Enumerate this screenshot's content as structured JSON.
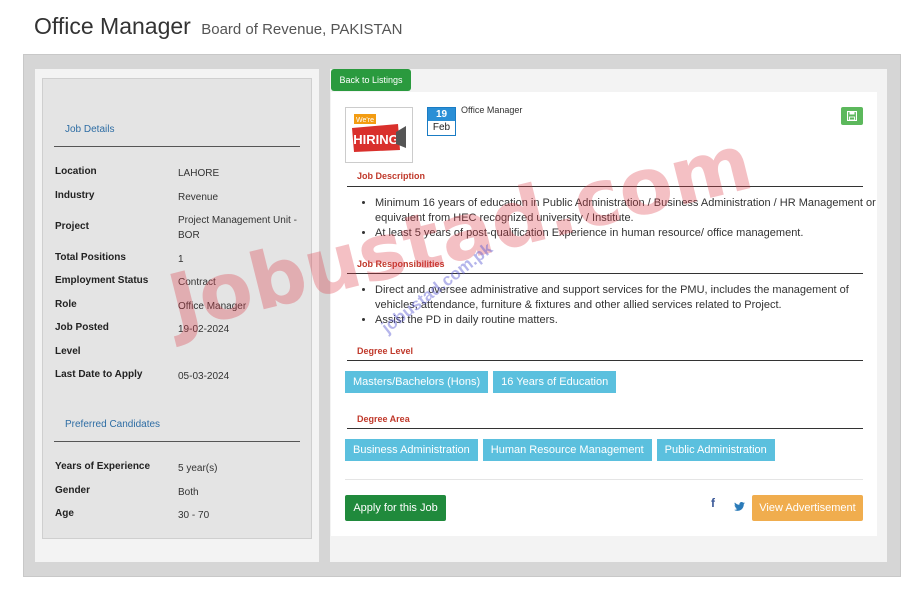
{
  "header": {
    "title": "Office Manager",
    "org": "Board of Revenue, PAKISTAN"
  },
  "sidebar": {
    "job_details_title": "Job Details",
    "details": [
      {
        "label": "Location",
        "value": "LAHORE"
      },
      {
        "label": "Industry",
        "value": "Revenue"
      },
      {
        "label": "Project",
        "value": "Project Management Unit - BOR"
      },
      {
        "label": "Total Positions",
        "value": "1"
      },
      {
        "label": "Employment Status",
        "value": "Contract"
      },
      {
        "label": "Role",
        "value": "Office Manager"
      },
      {
        "label": "Job Posted",
        "value": "19-02-2024"
      },
      {
        "label": "Level",
        "value": ""
      },
      {
        "label": "Last Date to Apply",
        "value": "05-03-2024"
      }
    ],
    "preferred_title": "Preferred Candidates",
    "preferred": [
      {
        "label": "Years of Experience",
        "value": "5 year(s)"
      },
      {
        "label": "Gender",
        "value": "Both"
      },
      {
        "label": "Age",
        "value": "30 - 70"
      }
    ]
  },
  "main": {
    "back_label": "Back to Listings",
    "logo": {
      "line1": "We're",
      "line2": "HIRING"
    },
    "date": {
      "day": "19",
      "month": "Feb"
    },
    "job_title_small": "Office Manager",
    "save_icon": "save-icon",
    "description_title": "Job Description",
    "description": [
      "Minimum 16 years of education in Public Administration / Business Administration / HR Management or equivalent from HEC recognized university / Institute.",
      "At least 5 years of post-qualification Experience in human resource/ office management."
    ],
    "responsibilities_title": "Job Responsibilities",
    "responsibilities": [
      "Direct and oversee administrative and support services for the PMU, includes the management of vehicles, attendance, furniture & fixtures and other allied services related to Project.",
      "Assist the PD in daily routine matters."
    ],
    "degree_level_title": "Degree Level",
    "degree_level": [
      "Masters/Bachelors (Hons)",
      "16 Years of Education"
    ],
    "degree_area_title": "Degree Area",
    "degree_area": [
      "Business Administration",
      "Human Resource Management",
      "Public Administration"
    ],
    "apply_label": "Apply for this Job",
    "facebook_glyph": "f",
    "view_label": "View Advertisement"
  },
  "watermark": {
    "big": "Jobustad.com",
    "small": "jobustad.com.pk"
  },
  "colors": {
    "green": "#2a9a3e",
    "info": "#5bc0de",
    "warning": "#f0ad4e",
    "accent_red": "#c0392b"
  }
}
